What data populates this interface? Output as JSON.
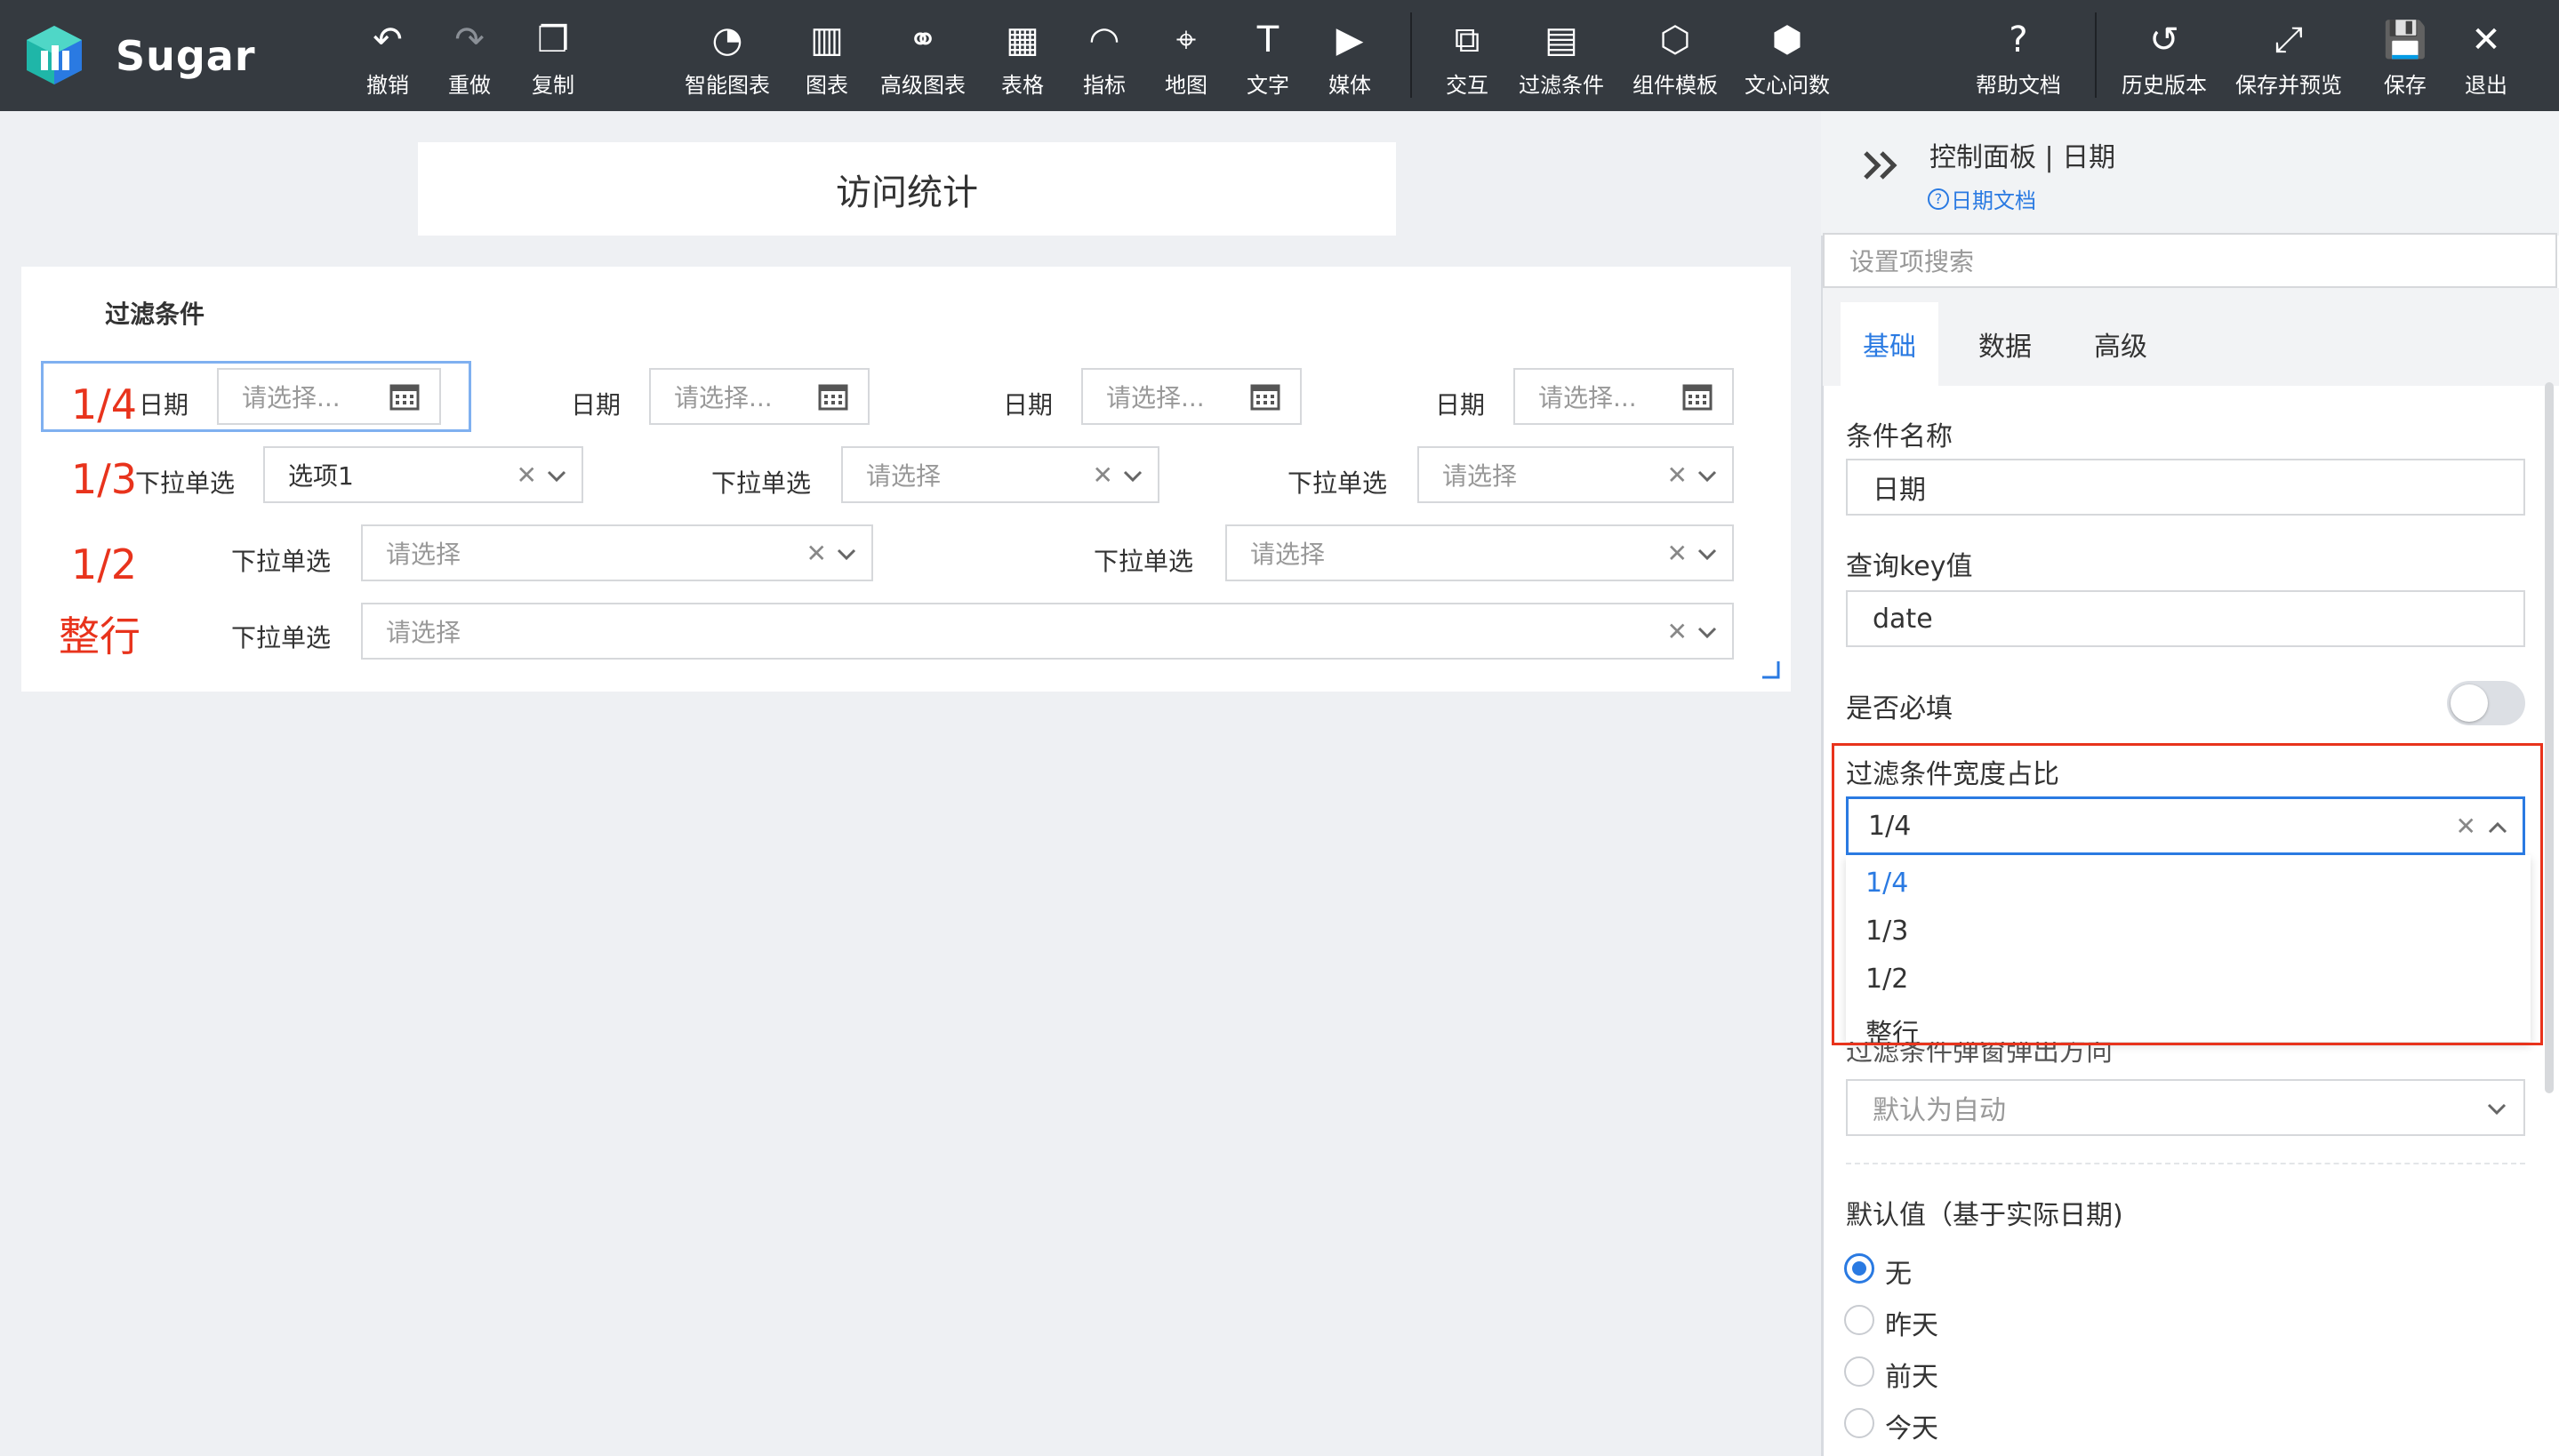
{
  "app": {
    "brand": "Sugar"
  },
  "toolbar": {
    "undo": "撤销",
    "redo": "重做",
    "copy": "复制",
    "smart_chart": "智能图表",
    "chart": "图表",
    "advanced_chart": "高级图表",
    "table": "表格",
    "indicator": "指标",
    "map": "地图",
    "text": "文字",
    "media": "媒体",
    "interaction": "交互",
    "filter": "过滤条件",
    "component_template": "组件模板",
    "wenxin": "文心问数",
    "help": "帮助文档",
    "history": "历史版本",
    "save_preview": "保存并预览",
    "save": "保存",
    "exit": "退出"
  },
  "canvas": {
    "title": "访问统计",
    "filter_panel": {
      "title": "过滤条件",
      "annotations": {
        "quarter": "1/4",
        "third": "1/3",
        "half": "1/2",
        "full": "整行"
      },
      "date_label": "日期",
      "date_placeholder": "请选择...",
      "dropdown_label": "下拉单选",
      "dropdown_placeholder": "请选择",
      "dropdown_value": "选项1"
    }
  },
  "side_panel": {
    "title": "控制面板 | 日期",
    "doc_link": "日期文档",
    "search_placeholder": "设置项搜索",
    "tabs": [
      "基础",
      "数据",
      "高级"
    ],
    "condition_name_label": "条件名称",
    "condition_name_value": "日期",
    "query_key_label": "查询key值",
    "query_key_value": "date",
    "required_label": "是否必填",
    "required_on": false,
    "width_ratio_label": "过滤条件宽度占比",
    "width_ratio_value": "1/4",
    "width_ratio_options": [
      "1/4",
      "1/3",
      "1/2",
      "整行"
    ],
    "popup_direction_label": "过滤条件弹窗弹出方向",
    "popup_direction_placeholder": "默认为自动",
    "default_value_label": "默认值（基于实际日期)",
    "default_options": [
      "无",
      "昨天",
      "前天",
      "今天"
    ],
    "default_selected": "无"
  },
  "colors": {
    "accent": "#2a7ae2",
    "highlight": "#e8331c",
    "toolbar_bg": "#353a40"
  }
}
